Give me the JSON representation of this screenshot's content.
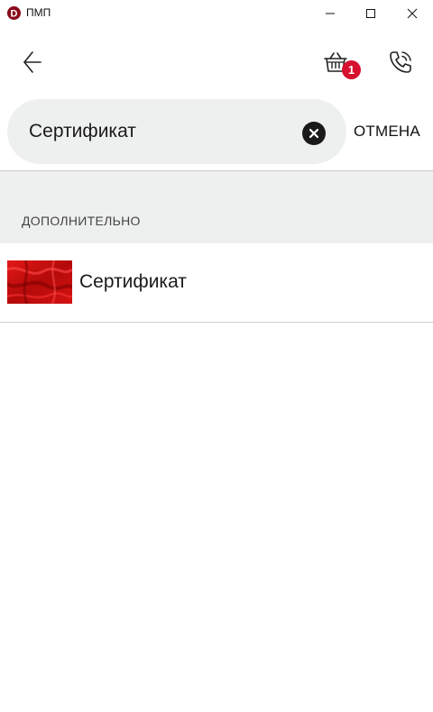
{
  "window": {
    "title": "ПМП",
    "logo_letter": "D",
    "accent_color": "#d6102e"
  },
  "header": {
    "back_icon": "arrow-left-icon",
    "cart_icon": "basket-icon",
    "cart_count": "1",
    "phone_icon": "phone-icon"
  },
  "search": {
    "value": "Сертификат",
    "placeholder": "",
    "clear_icon": "clear-circle-icon",
    "cancel_label": "ОТМЕНА"
  },
  "results": {
    "section_title": "ДОПОЛНИТЕЛЬНО",
    "items": [
      {
        "label": "Сертификат",
        "thumbnail": "red-fabric-image"
      }
    ]
  }
}
